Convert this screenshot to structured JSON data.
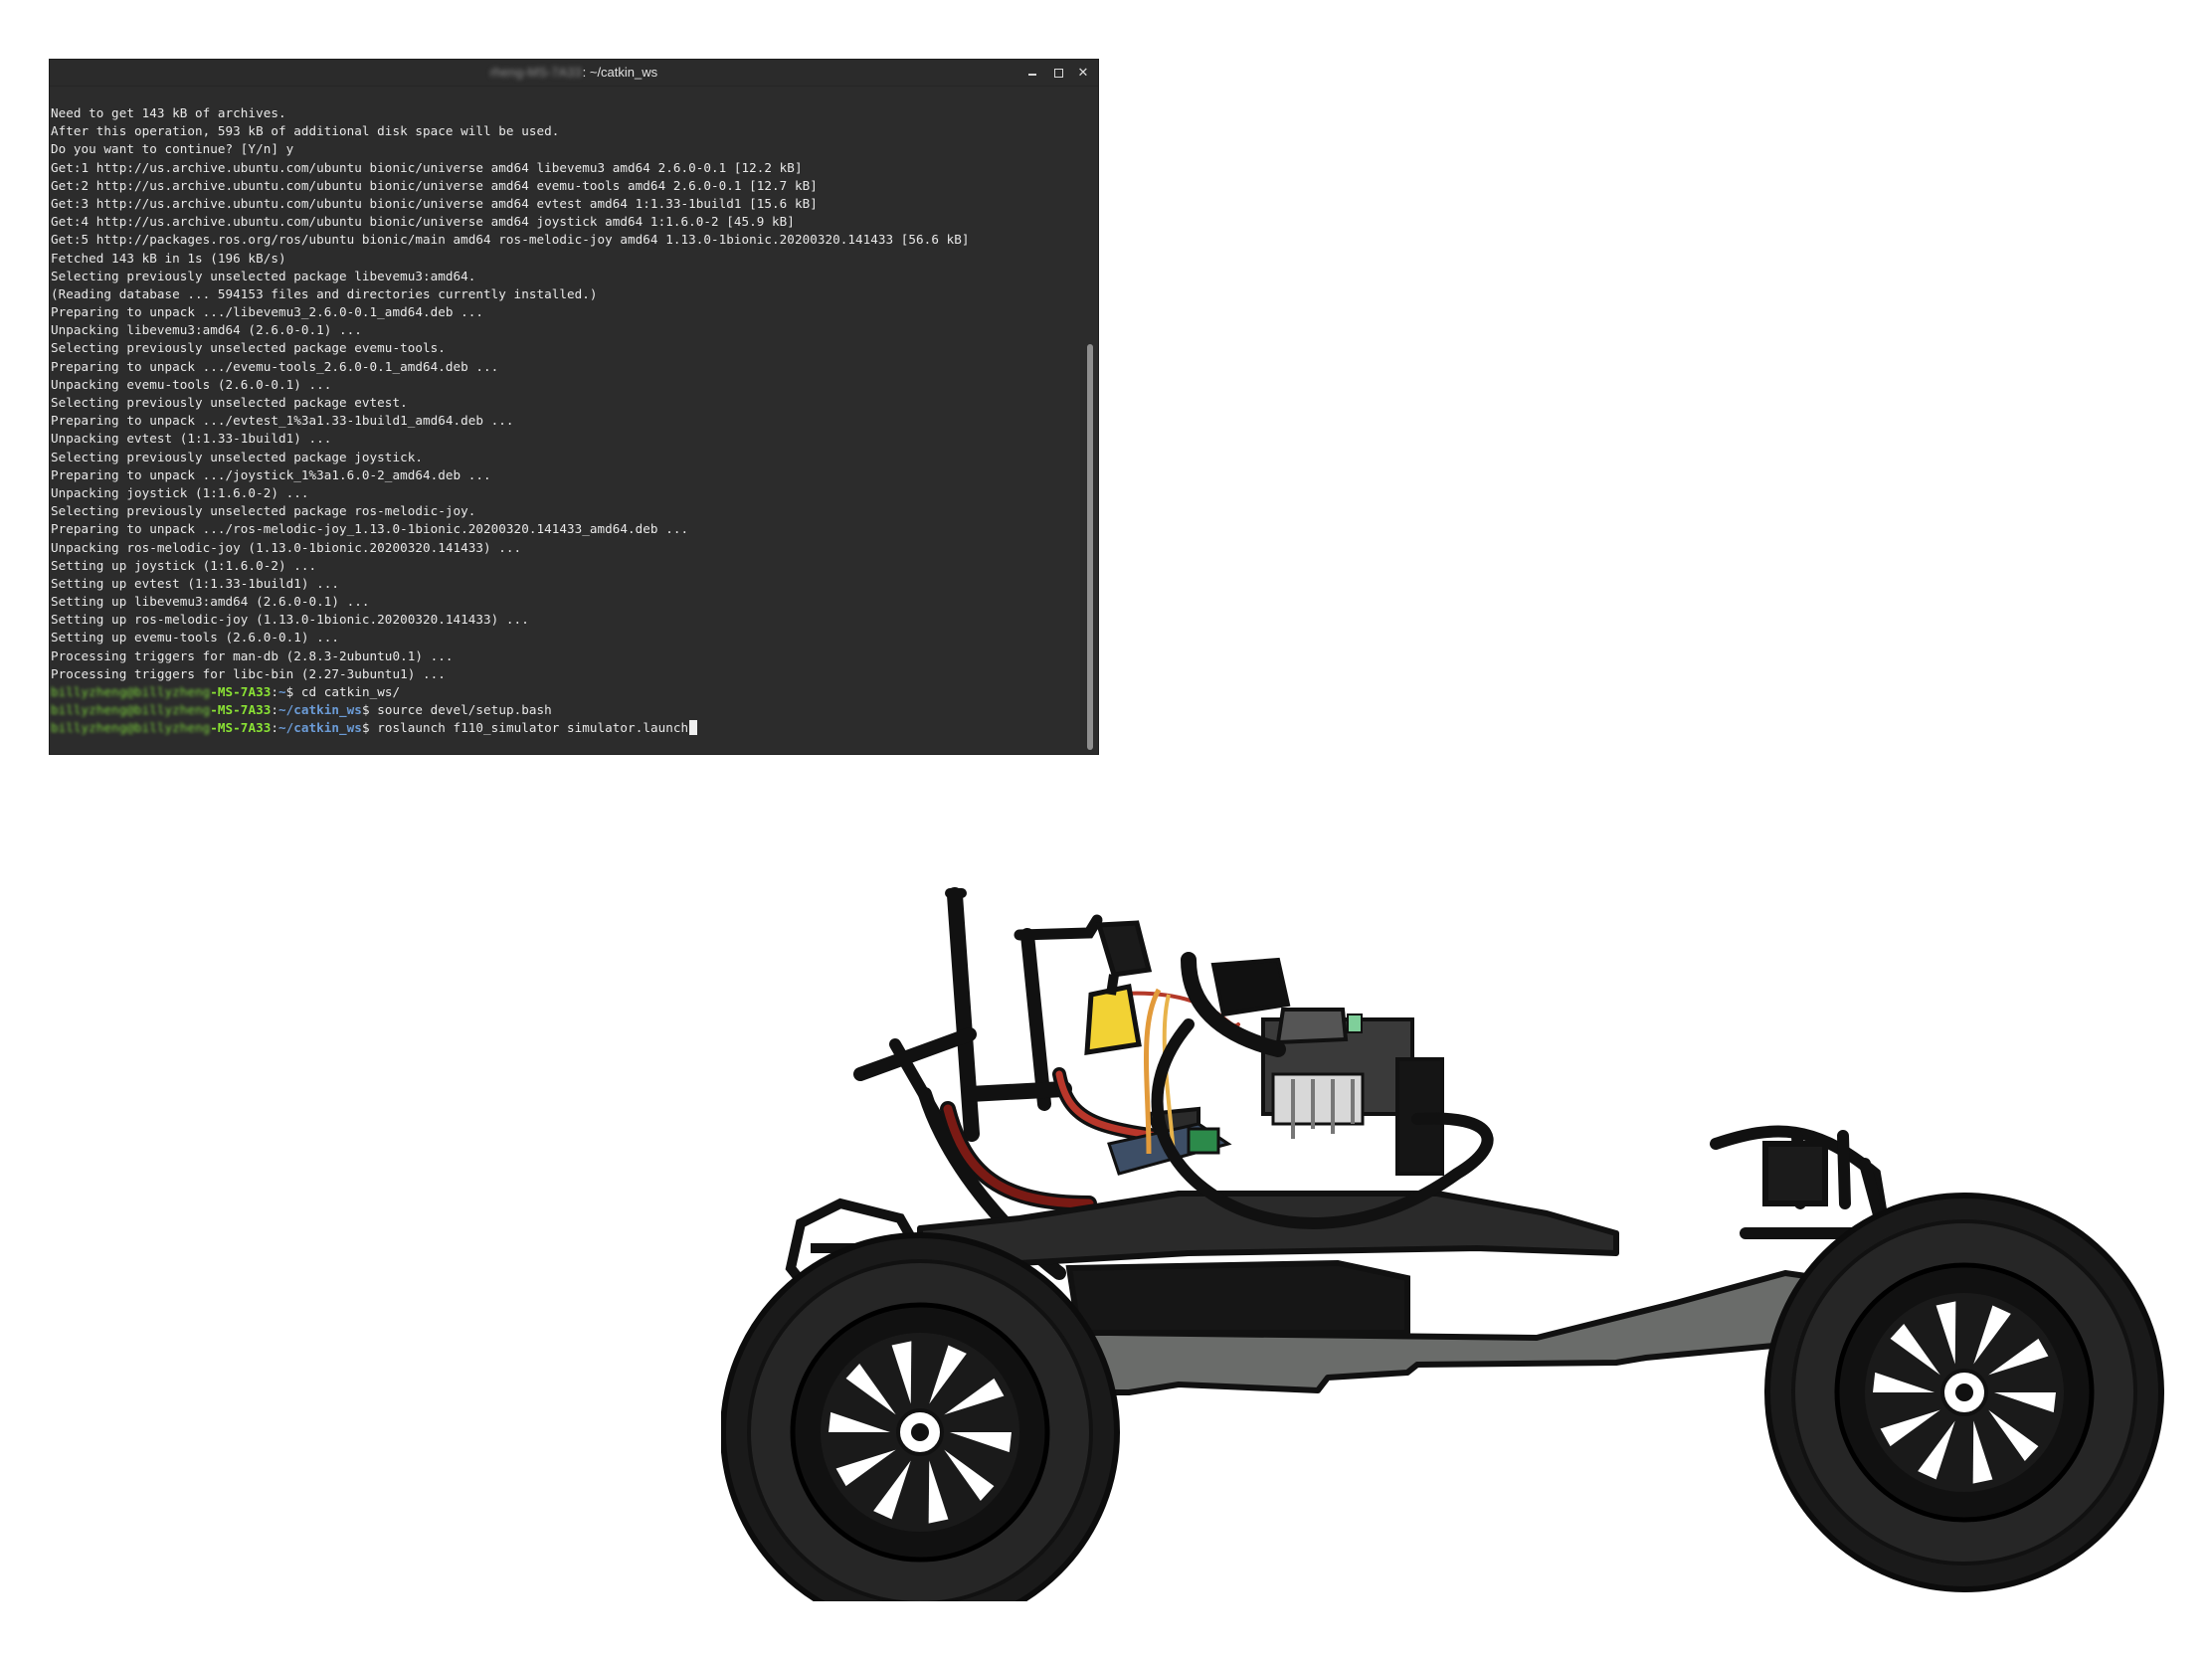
{
  "window": {
    "title_user_blurred": "rheng-MS-7A33",
    "title_path": ": ~/catkin_ws",
    "controls": {
      "minimize": "minimize",
      "maximize": "maximize",
      "close": "✕"
    }
  },
  "terminal": {
    "output_lines": [
      "Need to get 143 kB of archives.",
      "After this operation, 593 kB of additional disk space will be used.",
      "Do you want to continue? [Y/n] y",
      "Get:1 http://us.archive.ubuntu.com/ubuntu bionic/universe amd64 libevemu3 amd64 2.6.0-0.1 [12.2 kB]",
      "Get:2 http://us.archive.ubuntu.com/ubuntu bionic/universe amd64 evemu-tools amd64 2.6.0-0.1 [12.7 kB]",
      "Get:3 http://us.archive.ubuntu.com/ubuntu bionic/universe amd64 evtest amd64 1:1.33-1build1 [15.6 kB]",
      "Get:4 http://us.archive.ubuntu.com/ubuntu bionic/universe amd64 joystick amd64 1:1.6.0-2 [45.9 kB]",
      "Get:5 http://packages.ros.org/ros/ubuntu bionic/main amd64 ros-melodic-joy amd64 1.13.0-1bionic.20200320.141433 [56.6 kB]",
      "Fetched 143 kB in 1s (196 kB/s)",
      "Selecting previously unselected package libevemu3:amd64.",
      "(Reading database ... 594153 files and directories currently installed.)",
      "Preparing to unpack .../libevemu3_2.6.0-0.1_amd64.deb ...",
      "Unpacking libevemu3:amd64 (2.6.0-0.1) ...",
      "Selecting previously unselected package evemu-tools.",
      "Preparing to unpack .../evemu-tools_2.6.0-0.1_amd64.deb ...",
      "Unpacking evemu-tools (2.6.0-0.1) ...",
      "Selecting previously unselected package evtest.",
      "Preparing to unpack .../evtest_1%3a1.33-1build1_amd64.deb ...",
      "Unpacking evtest (1:1.33-1build1) ...",
      "Selecting previously unselected package joystick.",
      "Preparing to unpack .../joystick_1%3a1.6.0-2_amd64.deb ...",
      "Unpacking joystick (1:1.6.0-2) ...",
      "Selecting previously unselected package ros-melodic-joy.",
      "Preparing to unpack .../ros-melodic-joy_1.13.0-1bionic.20200320.141433_amd64.deb ...",
      "Unpacking ros-melodic-joy (1.13.0-1bionic.20200320.141433) ...",
      "Setting up joystick (1:1.6.0-2) ...",
      "Setting up evtest (1:1.33-1build1) ...",
      "Setting up libevemu3:amd64 (2.6.0-0.1) ...",
      "Setting up ros-melodic-joy (1.13.0-1bionic.20200320.141433) ...",
      "Setting up evemu-tools (2.6.0-0.1) ...",
      "Processing triggers for man-db (2.8.3-2ubuntu0.1) ...",
      "Processing triggers for libc-bin (2.27-3ubuntu1) ..."
    ],
    "prompts": [
      {
        "user": "billyzheng@billyzheng",
        "host": "-MS-7A33",
        "sep": ":",
        "path": "~",
        "symbol": "$ ",
        "command": "cd catkin_ws/"
      },
      {
        "user": "billyzheng@billyzheng",
        "host": "-MS-7A33",
        "sep": ":",
        "path": "~/catkin_ws",
        "symbol": "$ ",
        "command": "source devel/setup.bash"
      },
      {
        "user": "billyzheng@billyzheng",
        "host": "-MS-7A33",
        "sep": ":",
        "path": "~/catkin_ws",
        "symbol": "$ ",
        "command": "roslaunch f110_simulator simulator.launch"
      }
    ]
  },
  "colors": {
    "terminal_bg": "#2c2c2c",
    "terminal_text": "#e9e9e9",
    "prompt_host": "#8ae234",
    "prompt_path": "#6b9bd6",
    "scrollbar_thumb": "#8f8f8f"
  },
  "illustration": {
    "subject": "rc-car-chassis",
    "icons": [
      "wheel-icon",
      "battery-icon",
      "servo-icon",
      "circuit-board-icon"
    ]
  }
}
